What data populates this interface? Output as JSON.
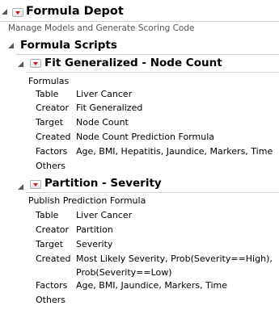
{
  "depot": {
    "title": "Formula Depot",
    "subtitle": "Manage Models and Generate Scoring Code"
  },
  "scripts": {
    "title": "Formula Scripts"
  },
  "fit": {
    "title": "Fit Generalized - Node Count",
    "section_label": "Formulas",
    "rows": [
      {
        "key": "Table",
        "value": "Liver Cancer"
      },
      {
        "key": "Creator",
        "value": "Fit Generalized"
      },
      {
        "key": "Target",
        "value": "Node Count"
      },
      {
        "key": "Created",
        "value": "Node Count Prediction Formula"
      },
      {
        "key": "Factors",
        "value": "Age, BMI, Hepatitis, Jaundice, Markers, Time"
      },
      {
        "key": "Others",
        "value": ""
      }
    ]
  },
  "partition": {
    "title": "Partition - Severity",
    "section_label": "Publish Prediction Formula",
    "rows": [
      {
        "key": "Table",
        "value": "Liver Cancer"
      },
      {
        "key": "Creator",
        "value": "Partition"
      },
      {
        "key": "Target",
        "value": "Severity"
      },
      {
        "key": "Created",
        "value": "Most Likely Severity, Prob(Severity==High),",
        "value2": "Prob(Severity==Low)"
      },
      {
        "key": "Factors",
        "value": "Age, BMI, Jaundice, Markers, Time"
      },
      {
        "key": "Others",
        "value": ""
      }
    ]
  }
}
